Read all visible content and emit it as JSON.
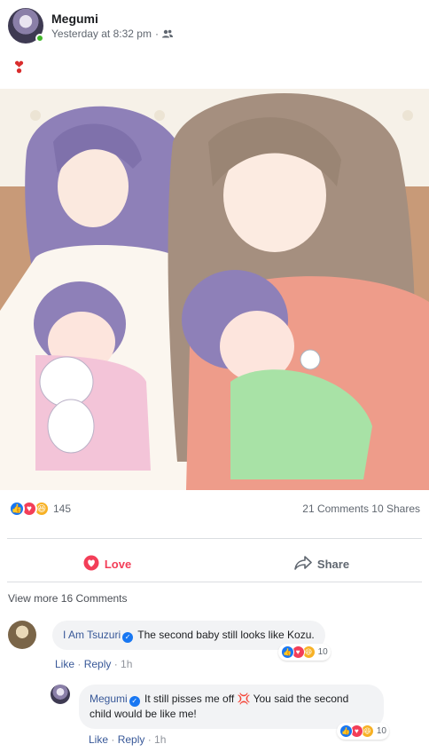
{
  "post": {
    "author": "Megumi",
    "timestamp": "Yesterday at 8:32 pm",
    "privacy_icon": "friends-icon",
    "separator": "·",
    "text_emoji": "❣",
    "reactions_count": "145",
    "comments_shares": "21 Comments 10 Shares"
  },
  "actions": {
    "love_label": "Love",
    "share_label": "Share"
  },
  "comments_section": {
    "view_more": "View more 16 Comments",
    "comments": [
      {
        "author": "I Am Tsuzuri",
        "text": "The second baby still looks like Kozu.",
        "reactions": "10",
        "like": "Like",
        "reply": "Reply",
        "time": "1h"
      },
      {
        "author": "Megumi",
        "text_part1": "It still pisses me off",
        "text_emoji": "💢",
        "text_part2": "You said the second child would be like me!",
        "reactions": "10",
        "like": "Like",
        "reply": "Reply",
        "time": "1h"
      }
    ]
  },
  "colors": {
    "like_blue": "#1877f2",
    "love_red": "#f33e58",
    "haha_yellow": "#f7b125",
    "link_blue": "#385898"
  }
}
